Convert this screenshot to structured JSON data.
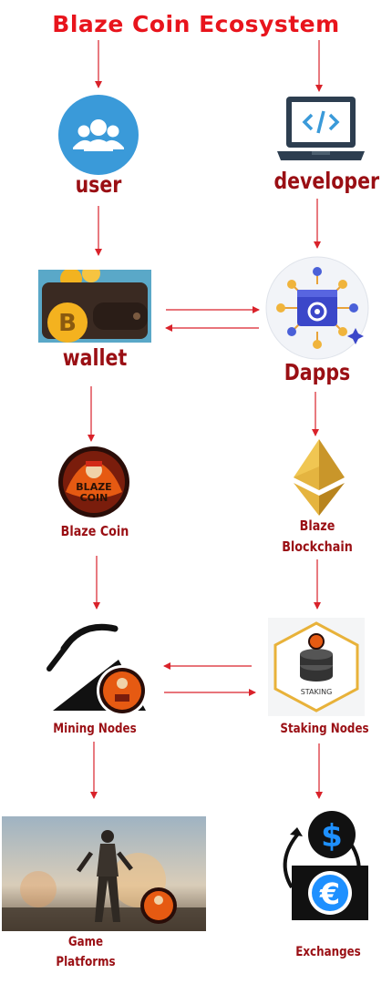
{
  "title": "Blaze Coin Ecosystem",
  "nodes": {
    "user": "user",
    "developer": "developer",
    "wallet": "wallet",
    "dapps": "Dapps",
    "blaze_coin": "Blaze Coin",
    "blaze_blockchain_line1": "Blaze",
    "blaze_blockchain_line2": "Blockchain",
    "mining_nodes": "Mining Nodes",
    "staking_nodes": "Staking Nodes",
    "game_platforms_line1": "Game",
    "game_platforms_line2": "Platforms",
    "exchanges": "Exchanges"
  },
  "icons": {
    "user": "users-group-icon",
    "developer": "laptop-code-icon",
    "wallet": "bitcoin-wallet-icon",
    "dapps": "dapp-chip-icon",
    "blaze_coin": "blaze-coin-logo",
    "blaze_blockchain": "ethereum-diamond-icon",
    "mining_nodes": "pickaxe-mining-icon",
    "staking_nodes": "staking-stack-icon",
    "game_platforms": "soldier-game-image",
    "exchanges": "currency-exchange-icon"
  },
  "badges": {
    "wallet_letter": "B",
    "staking_label": "STAKING",
    "dollar": "$",
    "euro": "€"
  },
  "colors": {
    "title": "#e8141c",
    "label": "#9a0f14",
    "arrow": "#d9222a",
    "user_circle": "#3a9ad9",
    "laptop": "#2d3e50"
  }
}
